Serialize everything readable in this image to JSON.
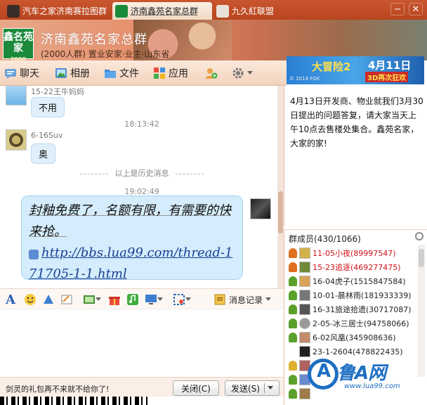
{
  "tabs": [
    {
      "label": "汽车之家济南赛拉图群",
      "active": false
    },
    {
      "label": "济南鑫苑名家总群",
      "active": true
    },
    {
      "label": "九久紅联盟",
      "active": false
    }
  ],
  "window": {
    "minimize": "−",
    "close": "✕"
  },
  "group": {
    "logo_text": "鑫名苑家",
    "logo_year": "2000",
    "name": "济南鑫苑名家总群",
    "description": "(2000人群) 置业安家·业主·山东省"
  },
  "toolbar": {
    "chat": "聊天",
    "album": "相册",
    "files": "文件",
    "apps": "应用"
  },
  "messages": [
    {
      "sender": "15-22王牛妈妈",
      "text": "不用"
    },
    {
      "time": "18:13:42"
    },
    {
      "sender": "6-16Suv",
      "text": "奥"
    },
    {
      "history_divider": "以上是历史消息"
    },
    {
      "time": "19:02:49"
    },
    {
      "text": "封釉免费了，名额有限，有需要的快来抢。",
      "link": "http://bbs.lua99.com/thread-171705-1-1.html"
    }
  ],
  "input_toolbar": {
    "history": "消息记录"
  },
  "bottom": {
    "ad": "剑灵的礼包再不来就不给你了!",
    "close_label": "关闭(C)",
    "send_label": "发送(S)"
  },
  "banner": {
    "big": "大冒险2",
    "date": "4月11日",
    "sub": "3D再次狂欢",
    "small": "© 2014 FOX"
  },
  "notice": "4月13日开发商、物业就我们3月30日提出的问题答复，请大家当天上午10点去售楼处集合。鑫苑名家，大家的家!",
  "members": {
    "title": "群成员(430/1066)",
    "list": [
      {
        "name": "11-05小夜(89997547)",
        "color": "#d0141c",
        "role": "#e07020"
      },
      {
        "name": "15-23追逐(469277475)",
        "color": "#d0141c",
        "role": "#e07020"
      },
      {
        "name": "16-04虎子(1515847584)",
        "color": "#111111",
        "role": "#5aa02a"
      },
      {
        "name": "10-01-晨林雨(181933339)",
        "color": "#111111",
        "role": "#5aa02a"
      },
      {
        "name": "16-31旅途拾遗(30717087)",
        "color": "#111111",
        "role": "#5aa02a"
      },
      {
        "name": "2-05-冰三居士(94758066)",
        "color": "#111111",
        "role": "#5aa02a"
      },
      {
        "name": "6-02风凰(345908636)",
        "color": "#111111",
        "role": "#5aa02a"
      },
      {
        "name": "23-1-2604(478822435)",
        "color": "#111111",
        "role": ""
      }
    ]
  },
  "watermark": {
    "brand": "鲁A网",
    "url": "www.lua99.com"
  }
}
